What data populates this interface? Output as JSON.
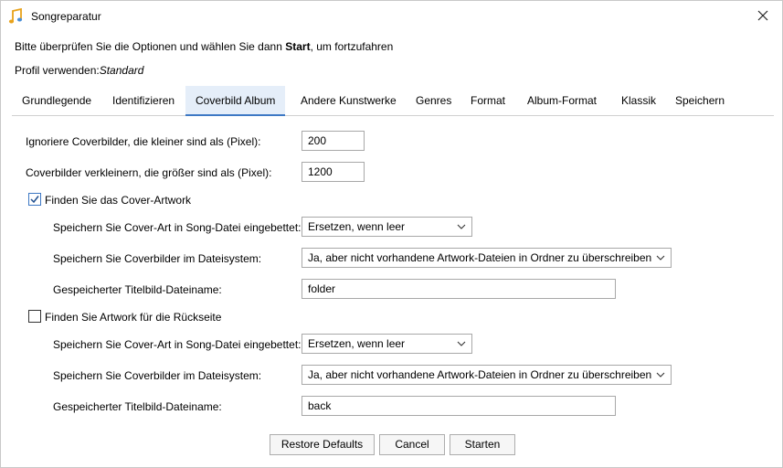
{
  "window": {
    "title": "Songreparatur",
    "close_icon": "close-icon",
    "app_icon": "music-note-icon"
  },
  "instruction": {
    "prefix": "Bitte überprüfen Sie die Optionen und wählen Sie dann ",
    "bold": "Start",
    "suffix": ", um fortzufahren"
  },
  "profile": {
    "label": "Profil verwenden:",
    "value": "Standard"
  },
  "tabs": [
    {
      "label": "Grundlegende"
    },
    {
      "label": "Identifizieren"
    },
    {
      "label": "Coverbild Album"
    },
    {
      "label": "Andere Kunstwerke"
    },
    {
      "label": "Genres"
    },
    {
      "label": "Format"
    },
    {
      "label": "Album-Format"
    },
    {
      "label": "Klassik"
    },
    {
      "label": "Speichern"
    }
  ],
  "active_tab": "Coverbild Album",
  "form": {
    "ignore_small_label": "Ignoriere Coverbilder, die kleiner sind als (Pixel):",
    "ignore_small_value": "200",
    "shrink_large_label": "Coverbilder verkleinern, die größer sind als (Pixel):",
    "shrink_large_value": "1200",
    "front": {
      "checkbox_label": "Finden Sie das Cover-Artwork",
      "checked": true,
      "embed_label": "Speichern Sie Cover-Art in Song-Datei eingebettet:",
      "embed_value": "Ersetzen, wenn leer",
      "filesystem_label": "Speichern Sie Coverbilder im Dateisystem:",
      "filesystem_value": "Ja, aber nicht vorhandene Artwork-Dateien in Ordner zu überschreiben",
      "filename_label": "Gespeicherter Titelbild-Dateiname:",
      "filename_value": "folder"
    },
    "back": {
      "checkbox_label": "Finden Sie Artwork für die Rückseite",
      "checked": false,
      "embed_label": "Speichern Sie Cover-Art in Song-Datei eingebettet:",
      "embed_value": "Ersetzen, wenn leer",
      "filesystem_label": "Speichern Sie Coverbilder im Dateisystem:",
      "filesystem_value": "Ja, aber nicht vorhandene Artwork-Dateien in Ordner zu überschreiben",
      "filename_label": "Gespeicherter Titelbild-Dateiname:",
      "filename_value": "back"
    }
  },
  "buttons": {
    "restore": "Restore Defaults",
    "cancel": "Cancel",
    "start": "Starten"
  },
  "colors": {
    "accent": "#3d78c4",
    "active_tab_bg": "#e5eef9"
  }
}
